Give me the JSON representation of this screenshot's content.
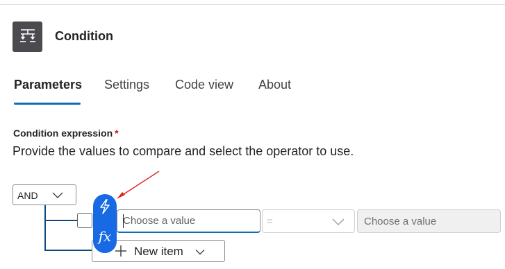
{
  "header": {
    "title": "Condition",
    "icon": "condition-icon"
  },
  "tabs": [
    {
      "label": "Parameters",
      "active": true
    },
    {
      "label": "Settings",
      "active": false
    },
    {
      "label": "Code view",
      "active": false
    },
    {
      "label": "About",
      "active": false
    }
  ],
  "condition": {
    "label": "Condition expression",
    "required_marker": "*",
    "description": "Provide the values to compare and select the operator to use.",
    "group_operator": "AND",
    "row": {
      "left_placeholder": "Choose a value",
      "operator": "=",
      "right_placeholder": "Choose a value"
    },
    "token_picker": {
      "dynamic_icon": "lightning-icon",
      "expression_label": "fx"
    },
    "new_item_label": "New item"
  },
  "colors": {
    "accent": "#0f6cbd",
    "token_blue": "#1769e4",
    "required": "#c50f1f",
    "annotation_arrow": "#e02020"
  }
}
